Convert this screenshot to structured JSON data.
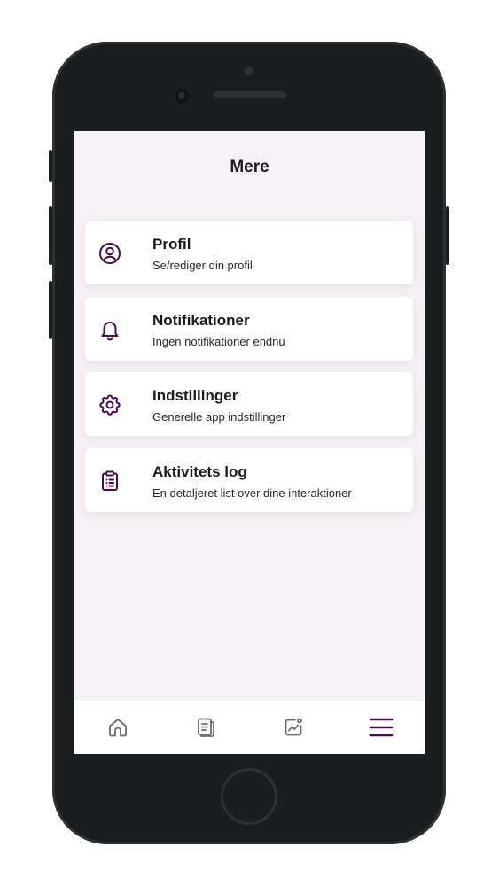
{
  "header": {
    "title": "Mere"
  },
  "menu": {
    "items": [
      {
        "icon": "user-circle-icon",
        "title": "Profil",
        "subtitle": "Se/rediger din profil"
      },
      {
        "icon": "bell-icon",
        "title": "Notifikationer",
        "subtitle": "Ingen notifikationer endnu"
      },
      {
        "icon": "gear-icon",
        "title": "Indstillinger",
        "subtitle": "Generelle app indstillinger"
      },
      {
        "icon": "clipboard-list-icon",
        "title": "Aktivitets log",
        "subtitle": "En detaljeret list over dine interaktioner"
      }
    ]
  },
  "tab_bar": {
    "tabs": [
      {
        "icon": "home-icon",
        "active": false
      },
      {
        "icon": "document-icon",
        "active": false
      },
      {
        "icon": "activity-chart-icon",
        "active": false
      },
      {
        "icon": "hamburger-menu-icon",
        "active": true
      }
    ]
  },
  "colors": {
    "accent": "#4a0a4f",
    "inactive_icon": "#6b6b70",
    "screen_background": "#f5f1f4",
    "card_background": "#ffffff",
    "device_frame": "#1b1e1f"
  }
}
